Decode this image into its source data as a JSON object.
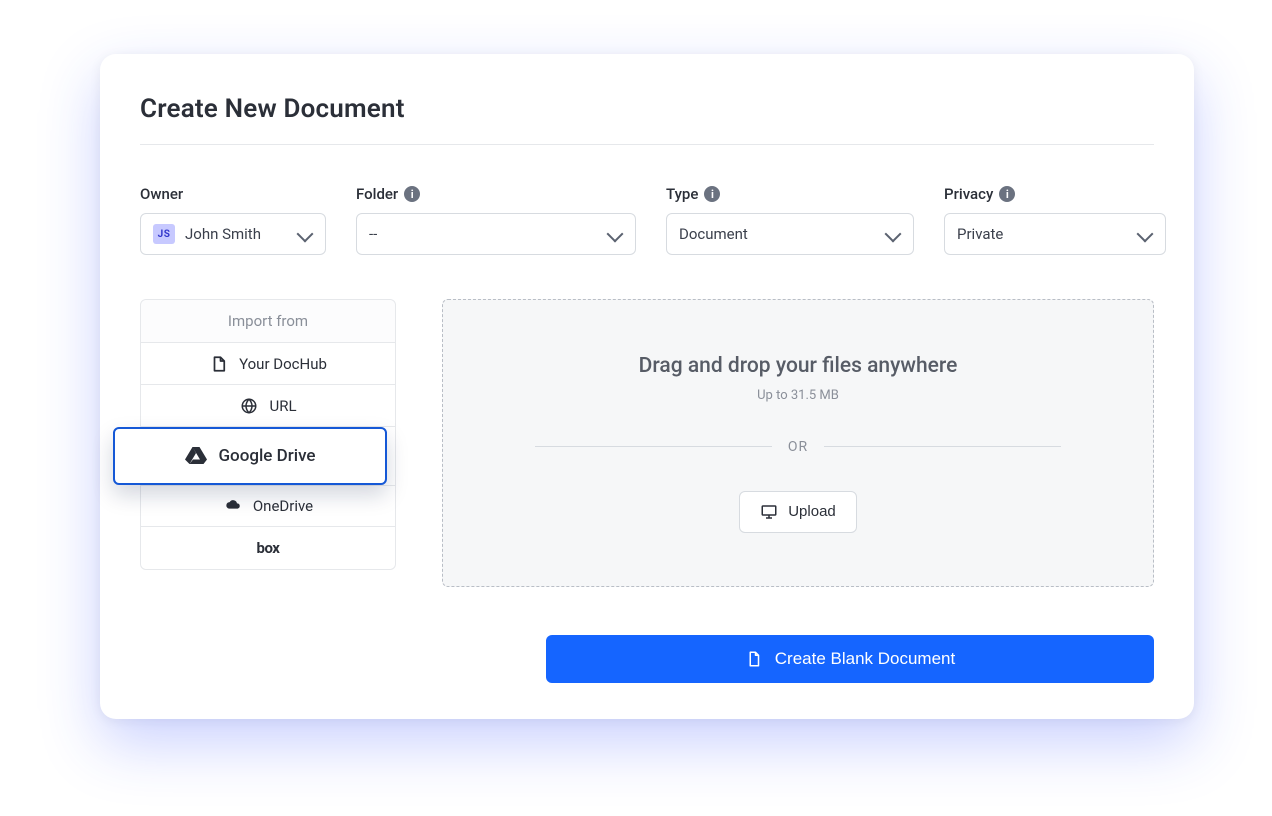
{
  "title": "Create New Document",
  "fields": {
    "owner": {
      "label": "Owner",
      "value": "John Smith",
      "initials": "JS"
    },
    "folder": {
      "label": "Folder",
      "value": "--"
    },
    "type": {
      "label": "Type",
      "value": "Document"
    },
    "privacy": {
      "label": "Privacy",
      "value": "Private"
    }
  },
  "import": {
    "header": "Import from",
    "items": {
      "dochub": "Your DocHub",
      "url": "URL",
      "gdrive": "Google Drive",
      "onedrive": "OneDrive",
      "box": "box"
    }
  },
  "dropzone": {
    "title": "Drag and drop your files anywhere",
    "sub": "Up to 31.5 MB",
    "or": "OR",
    "upload": "Upload"
  },
  "primary_button": "Create Blank Document"
}
